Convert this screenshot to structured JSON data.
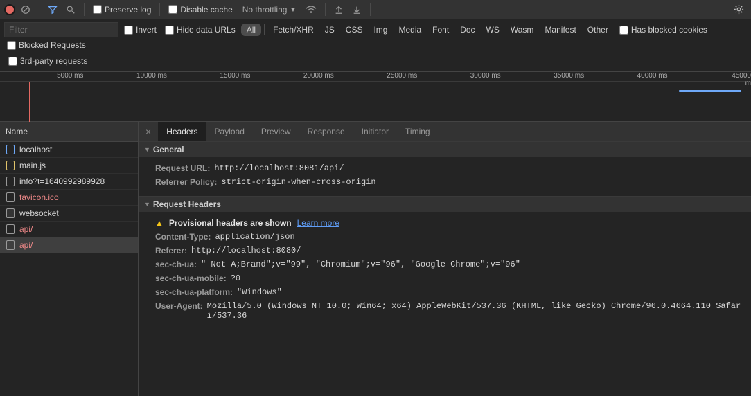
{
  "toolbar": {
    "preserve_log": "Preserve log",
    "disable_cache": "Disable cache",
    "throttling": "No throttling"
  },
  "filter": {
    "placeholder": "Filter",
    "invert": "Invert",
    "hide_data_urls": "Hide data URLs",
    "types": [
      "All",
      "Fetch/XHR",
      "JS",
      "CSS",
      "Img",
      "Media",
      "Font",
      "Doc",
      "WS",
      "Wasm",
      "Manifest",
      "Other"
    ],
    "active_type_index": 0,
    "has_blocked_cookies": "Has blocked cookies",
    "blocked_requests": "Blocked Requests",
    "third_party": "3rd-party requests"
  },
  "timeline": {
    "labels": [
      "5000 ms",
      "10000 ms",
      "15000 ms",
      "20000 ms",
      "25000 ms",
      "30000 ms",
      "35000 ms",
      "40000 ms",
      "45000 m"
    ]
  },
  "name_column": "Name",
  "requests": [
    {
      "name": "localhost",
      "icon": "doc-blue",
      "error": false
    },
    {
      "name": "main.js",
      "icon": "doc-yellow",
      "error": false
    },
    {
      "name": "info?t=1640992989928",
      "icon": "doc-grey",
      "error": false
    },
    {
      "name": "favicon.ico",
      "icon": "doc-grey",
      "error": true
    },
    {
      "name": "websocket",
      "icon": "doc-grey-fill",
      "error": false
    },
    {
      "name": "api/",
      "icon": "doc-grey",
      "error": true,
      "selected": false
    },
    {
      "name": "api/",
      "icon": "doc-grey",
      "error": true,
      "selected": true
    }
  ],
  "detail_tabs": [
    "Headers",
    "Payload",
    "Preview",
    "Response",
    "Initiator",
    "Timing"
  ],
  "active_detail_tab": 0,
  "general_section": "General",
  "general": [
    {
      "k": "Request URL:",
      "v": "http://localhost:8081/api/"
    },
    {
      "k": "Referrer Policy:",
      "v": "strict-origin-when-cross-origin"
    }
  ],
  "request_headers_section": "Request Headers",
  "provisional_warning": "Provisional headers are shown",
  "learn_more": "Learn more",
  "request_headers": [
    {
      "k": "Content-Type:",
      "v": "application/json"
    },
    {
      "k": "Referer:",
      "v": "http://localhost:8080/"
    },
    {
      "k": "sec-ch-ua:",
      "v": "\" Not A;Brand\";v=\"99\", \"Chromium\";v=\"96\", \"Google Chrome\";v=\"96\""
    },
    {
      "k": "sec-ch-ua-mobile:",
      "v": "?0"
    },
    {
      "k": "sec-ch-ua-platform:",
      "v": "\"Windows\""
    },
    {
      "k": "User-Agent:",
      "v": "Mozilla/5.0 (Windows NT 10.0; Win64; x64) AppleWebKit/537.36 (KHTML, like Gecko) Chrome/96.0.4664.110 Safari/537.36"
    }
  ]
}
